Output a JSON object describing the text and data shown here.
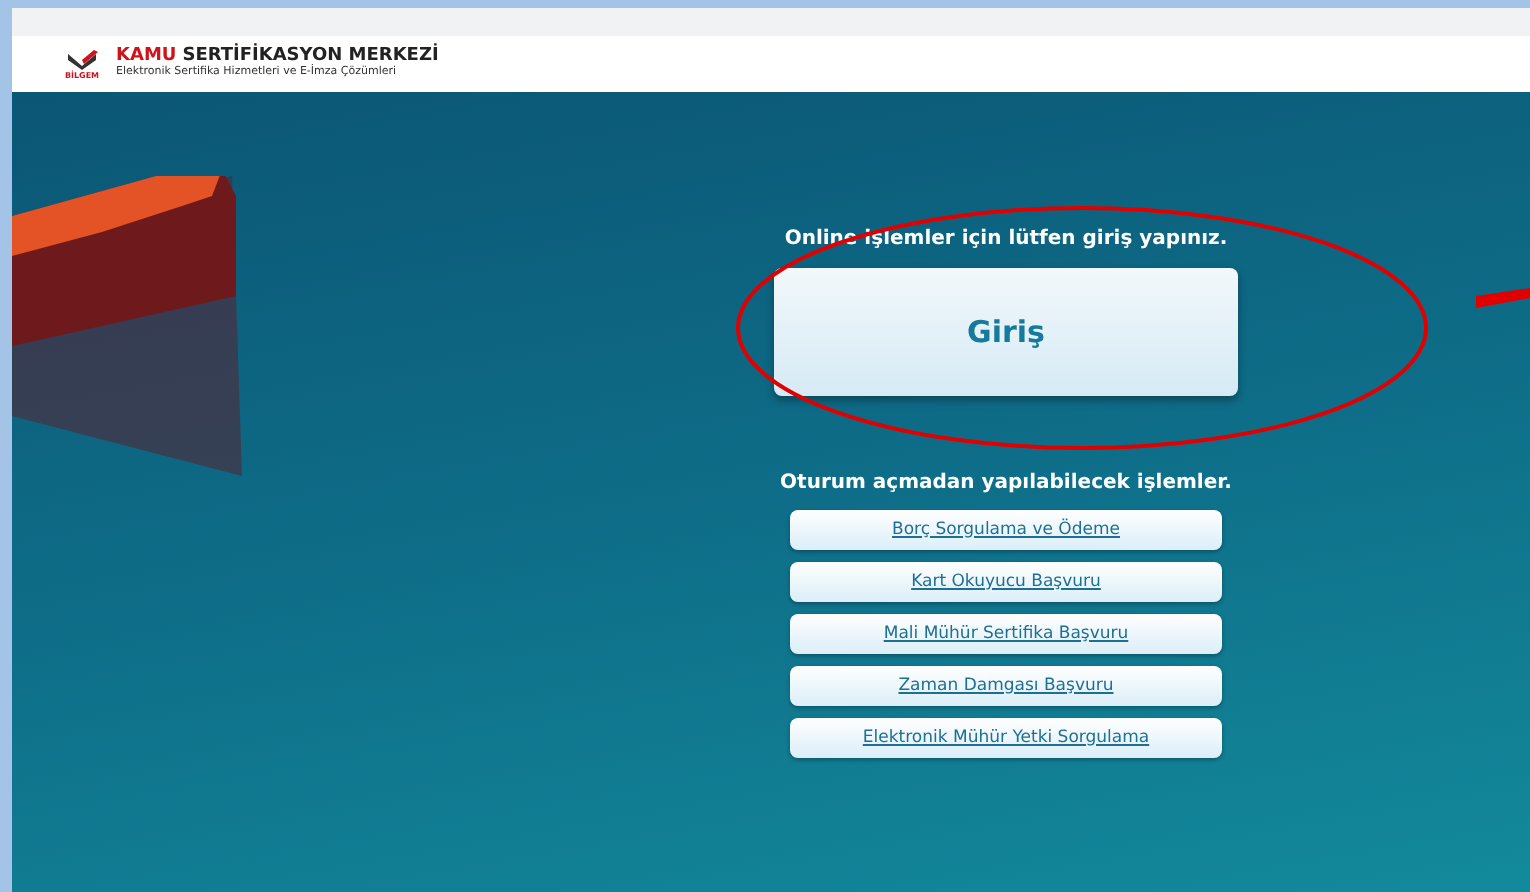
{
  "header": {
    "logo_caption": "BİLGEM",
    "title_accent": "KAMU",
    "title_rest": "SERTİFİKASYON MERKEZİ",
    "subtitle": "Elektronik Sertifika Hizmetleri ve E-İmza Çözümleri"
  },
  "login": {
    "prompt": "Online işlemler için lütfen giriş yapınız.",
    "button": "Giriş"
  },
  "guest": {
    "heading": "Oturum açmadan yapılabilecek işlemler.",
    "links": [
      "Borç Sorgulama ve Ödeme",
      "Kart Okuyucu Başvuru",
      "Mali Mühür Sertifika Başvuru",
      "Zaman Damgası Başvuru",
      "Elektronik Mühür Yetki Sorgulama"
    ]
  }
}
